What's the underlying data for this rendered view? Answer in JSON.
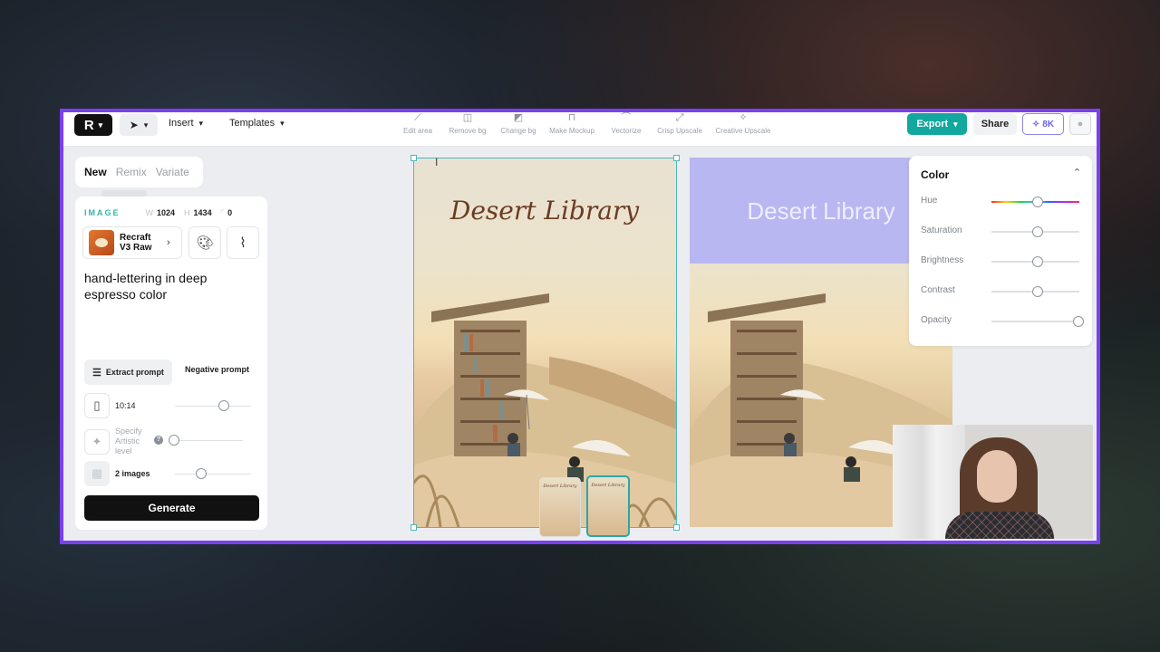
{
  "toolbar": {
    "logo_letter": "R",
    "menus": [
      "Insert",
      "Templates"
    ],
    "tools": [
      {
        "label": "Edit area",
        "icon": "edit-area-icon"
      },
      {
        "label": "Remove bg",
        "icon": "remove-bg-icon"
      },
      {
        "label": "Change bg",
        "icon": "change-bg-icon"
      },
      {
        "label": "Make Mockup",
        "icon": "mockup-icon"
      },
      {
        "label": "Vectorize",
        "icon": "vectorize-icon"
      },
      {
        "label": "Crisp Upscale",
        "icon": "crisp-upscale-icon"
      },
      {
        "label": "Creative Upscale",
        "icon": "creative-upscale-icon"
      }
    ],
    "export_label": "Export",
    "share_label": "Share",
    "credits_label": "8K"
  },
  "mode_tabs": [
    "New",
    "Remix",
    "Variate"
  ],
  "panel": {
    "image_label": "IMAGE",
    "width_key": "W",
    "width_value": "1024",
    "height_key": "H",
    "height_value": "1434",
    "rotation_value": "0",
    "model_name": "Recraft V3 Raw",
    "prompt": "hand-lettering in deep espresso color",
    "extract_label": "Extract prompt",
    "negative_label": "Negative prompt",
    "ratio_label": "10:14",
    "artistic_label": "Specify Artistic level",
    "images_label": "2 images",
    "generate_label": "Generate"
  },
  "canvas": {
    "left_title": "Desert Library",
    "right_title": "Desert Library",
    "thumb_title": "Desert Library"
  },
  "color_panel": {
    "title": "Color",
    "rows": [
      {
        "label": "Hue",
        "value": 0.5
      },
      {
        "label": "Saturation",
        "value": 0.5
      },
      {
        "label": "Brightness",
        "value": 0.5
      },
      {
        "label": "Contrast",
        "value": 0.5
      },
      {
        "label": "Opacity",
        "value": 1.0
      }
    ]
  },
  "colors": {
    "accent_teal": "#13a89e",
    "frame_purple": "#7b3ff2",
    "band_lavender": "#b8b7f1",
    "title_espresso": "#6b3c22"
  }
}
